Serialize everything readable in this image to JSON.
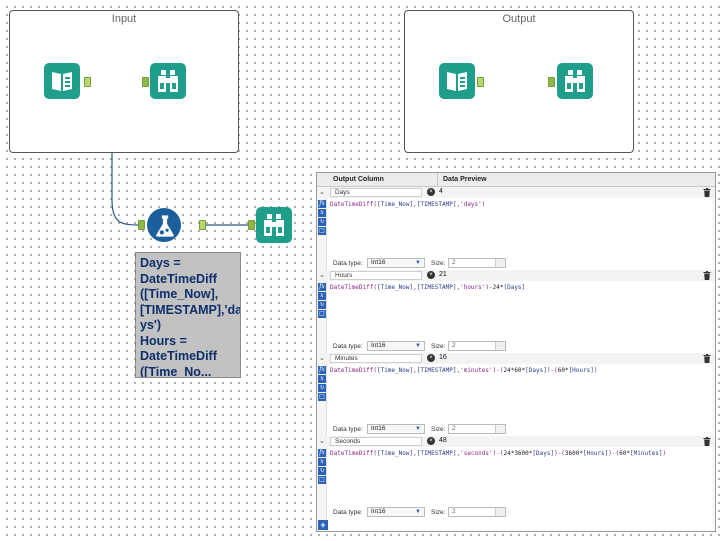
{
  "containers": {
    "input": {
      "title": "Input"
    },
    "output": {
      "title": "Output"
    }
  },
  "icons": {
    "input_tool": "book-icon",
    "browse_tool": "binoculars-icon",
    "formula_tool": "flask-icon",
    "clear": "close-icon",
    "delete": "trash-icon",
    "add": "plus-icon"
  },
  "colors": {
    "tool_teal": "#1f9e8b",
    "formula_blue": "#1b5f9c",
    "annotation_bg": "#c2c2c2",
    "annotation_text": "#0d2f6b",
    "anchor_green": "#b5d96a",
    "wire_blue": "#2a5a8a"
  },
  "annotation": {
    "lines": [
      "Days =",
      "DateTimeDiff",
      "([Time_Now],",
      "[TIMESTAMP],'da",
      "ys')",
      "Hours =",
      "DateTimeDiff",
      "([Time_No..."
    ]
  },
  "panel": {
    "header_output_column": "Output Column",
    "header_data_preview": "Data Preview",
    "data_type_label": "Data type:",
    "size_label": "Size:",
    "add_symbol": "+",
    "clear_symbol": "×",
    "fields": [
      {
        "name": "Days",
        "preview": "4",
        "expr_parts": [
          "DateTimeDiff(",
          "[Time_Now]",
          ",",
          "[TIMESTAMP]",
          ",",
          "'days'",
          ")"
        ],
        "data_type": "Int16",
        "size": "2"
      },
      {
        "name": "Hours",
        "preview": "21",
        "expr_parts": [
          "DateTimeDiff(",
          "[Time_Now]",
          ",",
          "[TIMESTAMP]",
          ",",
          "'hours'",
          ")-",
          "24",
          "*",
          "[Days]"
        ],
        "data_type": "Int16",
        "size": "2"
      },
      {
        "name": "Minutes",
        "preview": "16",
        "expr_parts": [
          "DateTimeDiff(",
          "[Time_Now]",
          ",",
          "[TIMESTAMP]",
          ",",
          "'minutes'",
          ")-(",
          "24",
          "*",
          "60",
          "*",
          "[Days]",
          ")-(",
          "60",
          "*",
          "[Hours]",
          ")"
        ],
        "data_type": "Int16",
        "size": "2"
      },
      {
        "name": "Seconds",
        "preview": "48",
        "expr_parts": [
          "DateTimeDiff(",
          "[Time_Now]",
          ",",
          "[TIMESTAMP]",
          ",",
          "'seconds'",
          ")-(",
          "24",
          "*",
          "3600",
          "*",
          "[Days]",
          ")-(",
          "3600",
          "*",
          "[Hours]",
          ")-(",
          "60",
          "*",
          "[Minutes]",
          ")"
        ],
        "data_type": "Int16",
        "size": "2"
      }
    ]
  }
}
